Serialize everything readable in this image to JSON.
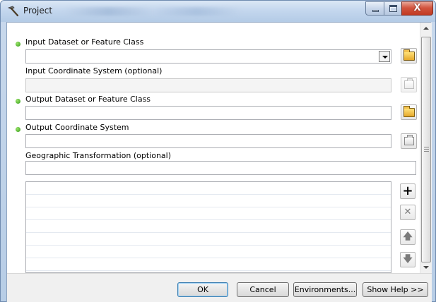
{
  "window": {
    "title": "Project",
    "subtitle_blurred": "Data Management Tools",
    "buttons": {
      "minimize": "minimize",
      "maximize": "maximize",
      "close": "X"
    }
  },
  "form": {
    "input_dataset": {
      "label": "Input Dataset or Feature Class",
      "value": "",
      "required": true
    },
    "input_coord_sys": {
      "label": "Input Coordinate System (optional)",
      "value": "",
      "disabled": true
    },
    "output_dataset": {
      "label": "Output Dataset or Feature Class",
      "value": "",
      "required": true
    },
    "output_coord_sys": {
      "label": "Output Coordinate System",
      "value": "",
      "required": true
    },
    "geo_transform": {
      "label": "Geographic Transformation (optional)",
      "value": ""
    }
  },
  "list_buttons": {
    "add": "+",
    "remove": "✕",
    "up": "🡅",
    "down": "🡇"
  },
  "footer": {
    "ok_label": "OK",
    "cancel_label": "Cancel",
    "environments_label": "Environments...",
    "show_help_label": "Show Help >>"
  },
  "colors": {
    "required_dot": "#2f9a16",
    "titlebar": "#c4d7ee",
    "close_button": "#c13a22"
  },
  "icons": {
    "title": "hammer-icon",
    "browse": "open-folder-icon",
    "coord_props": "spatial-reference-properties-icon"
  }
}
